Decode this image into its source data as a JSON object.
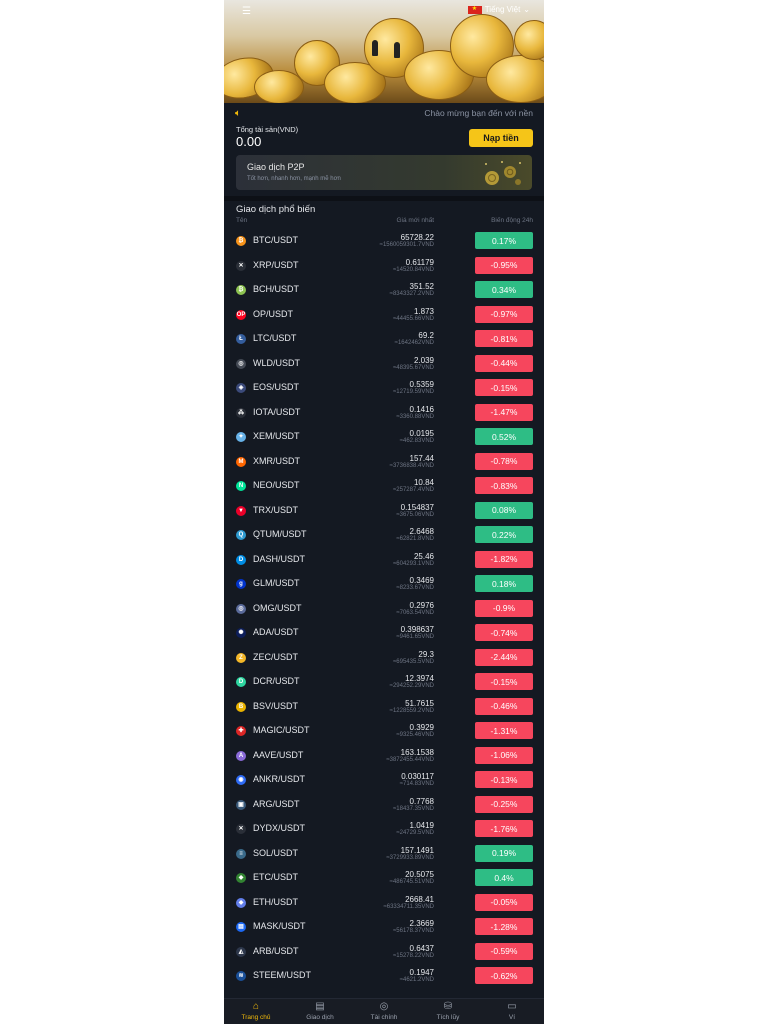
{
  "header": {
    "language": "Tiếng Việt",
    "notice": "Chào mừng bạn đến với nền"
  },
  "account": {
    "total_label": "Tổng tài sản(VND)",
    "total_value": "0.00",
    "deposit_label": "Nạp tiền"
  },
  "p2p": {
    "title": "Giao dịch P2P",
    "subtitle": "Tốt hơn, nhanh hơn, mạnh mẽ hơn"
  },
  "market": {
    "title": "Giao dịch phổ biến",
    "col_name": "Tên",
    "col_price": "Giá mới nhất",
    "col_change": "Biến động 24h",
    "rows": [
      {
        "pair": "BTC/USDT",
        "price": "65728.22",
        "vnd": "≈1560059301.7VND",
        "change": "0.17%",
        "dir": "up",
        "icon": "bitcoin-icon",
        "color": "#f7931a",
        "glyph": "₿"
      },
      {
        "pair": "XRP/USDT",
        "price": "0.61179",
        "vnd": "≈14520.84VND",
        "change": "-0.95%",
        "dir": "down",
        "icon": "xrp-icon",
        "color": "#2a2f38",
        "glyph": "✕"
      },
      {
        "pair": "BCH/USDT",
        "price": "351.52",
        "vnd": "≈8343327.2VND",
        "change": "0.34%",
        "dir": "up",
        "icon": "bitcoin-cash-icon",
        "color": "#8dc351",
        "glyph": "₿"
      },
      {
        "pair": "OP/USDT",
        "price": "1.873",
        "vnd": "≈44455.66VND",
        "change": "-0.97%",
        "dir": "down",
        "icon": "optimism-icon",
        "color": "#ff0420",
        "glyph": "OP"
      },
      {
        "pair": "LTC/USDT",
        "price": "69.2",
        "vnd": "≈1642462VND",
        "change": "-0.81%",
        "dir": "down",
        "icon": "litecoin-icon",
        "color": "#345d9d",
        "glyph": "Ł"
      },
      {
        "pair": "WLD/USDT",
        "price": "2.039",
        "vnd": "≈48395.67VND",
        "change": "-0.44%",
        "dir": "down",
        "icon": "worldcoin-icon",
        "color": "#444a55",
        "glyph": "◎"
      },
      {
        "pair": "EOS/USDT",
        "price": "0.5359",
        "vnd": "≈12719.59VND",
        "change": "-0.15%",
        "dir": "down",
        "icon": "eos-icon",
        "color": "#3b4a7a",
        "glyph": "◈"
      },
      {
        "pair": "IOTA/USDT",
        "price": "0.1416",
        "vnd": "≈3360.88VND",
        "change": "-1.47%",
        "dir": "down",
        "icon": "iota-icon",
        "color": "#2a2f38",
        "glyph": "⁂"
      },
      {
        "pair": "XEM/USDT",
        "price": "0.0195",
        "vnd": "≈462.83VND",
        "change": "0.52%",
        "dir": "up",
        "icon": "nem-icon",
        "color": "#67b2e8",
        "glyph": "✦"
      },
      {
        "pair": "XMR/USDT",
        "price": "157.44",
        "vnd": "≈3736838.4VND",
        "change": "-0.78%",
        "dir": "down",
        "icon": "monero-icon",
        "color": "#ff6600",
        "glyph": "M"
      },
      {
        "pair": "NEO/USDT",
        "price": "10.84",
        "vnd": "≈257287.4VND",
        "change": "-0.83%",
        "dir": "down",
        "icon": "neo-icon",
        "color": "#00e599",
        "glyph": "N"
      },
      {
        "pair": "TRX/USDT",
        "price": "0.154837",
        "vnd": "≈3675.06VND",
        "change": "0.08%",
        "dir": "up",
        "icon": "tron-icon",
        "color": "#eb0029",
        "glyph": "▼"
      },
      {
        "pair": "QTUM/USDT",
        "price": "2.6468",
        "vnd": "≈62821.8VND",
        "change": "0.22%",
        "dir": "up",
        "icon": "qtum-icon",
        "color": "#2e9ad0",
        "glyph": "Q"
      },
      {
        "pair": "DASH/USDT",
        "price": "25.46",
        "vnd": "≈604293.1VND",
        "change": "-1.82%",
        "dir": "down",
        "icon": "dash-icon",
        "color": "#008de4",
        "glyph": "D"
      },
      {
        "pair": "GLM/USDT",
        "price": "0.3469",
        "vnd": "≈8233.67VND",
        "change": "0.18%",
        "dir": "up",
        "icon": "golem-icon",
        "color": "#0033cc",
        "glyph": "g"
      },
      {
        "pair": "OMG/USDT",
        "price": "0.2976",
        "vnd": "≈7063.54VND",
        "change": "-0.9%",
        "dir": "down",
        "icon": "omg-icon",
        "color": "#5a6a9a",
        "glyph": "◎"
      },
      {
        "pair": "ADA/USDT",
        "price": "0.398637",
        "vnd": "≈9461.65VND",
        "change": "-0.74%",
        "dir": "down",
        "icon": "cardano-icon",
        "color": "#0d1e5a",
        "glyph": "✺"
      },
      {
        "pair": "ZEC/USDT",
        "price": "29.3",
        "vnd": "≈695435.5VND",
        "change": "-2.44%",
        "dir": "down",
        "icon": "zcash-icon",
        "color": "#f4b728",
        "glyph": "Z"
      },
      {
        "pair": "DCR/USDT",
        "price": "12.3974",
        "vnd": "≈294252.29VND",
        "change": "-0.15%",
        "dir": "down",
        "icon": "decred-icon",
        "color": "#2ed6a1",
        "glyph": "D"
      },
      {
        "pair": "BSV/USDT",
        "price": "51.7615",
        "vnd": "≈1228559.2VND",
        "change": "-0.46%",
        "dir": "down",
        "icon": "bitcoin-sv-icon",
        "color": "#eab300",
        "glyph": "B"
      },
      {
        "pair": "MAGIC/USDT",
        "price": "0.3929",
        "vnd": "≈9325.46VND",
        "change": "-1.31%",
        "dir": "down",
        "icon": "magic-icon",
        "color": "#dc2626",
        "glyph": "✚"
      },
      {
        "pair": "AAVE/USDT",
        "price": "163.1538",
        "vnd": "≈3872455.44VND",
        "change": "-1.06%",
        "dir": "down",
        "icon": "aave-icon",
        "color": "#8a6ad8",
        "glyph": "A"
      },
      {
        "pair": "ANKR/USDT",
        "price": "0.030117",
        "vnd": "≈714.83VND",
        "change": "-0.13%",
        "dir": "down",
        "icon": "ankr-icon",
        "color": "#2e6bf5",
        "glyph": "◉"
      },
      {
        "pair": "ARG/USDT",
        "price": "0.7768",
        "vnd": "≈18437.35VND",
        "change": "-0.25%",
        "dir": "down",
        "icon": "arg-icon",
        "color": "#3a5a7a",
        "glyph": "▣"
      },
      {
        "pair": "DYDX/USDT",
        "price": "1.0419",
        "vnd": "≈24729.5VND",
        "change": "-1.76%",
        "dir": "down",
        "icon": "dydx-icon",
        "color": "#2a2f38",
        "glyph": "✕"
      },
      {
        "pair": "SOL/USDT",
        "price": "157.1491",
        "vnd": "≈3729933.89VND",
        "change": "0.19%",
        "dir": "up",
        "icon": "solana-icon",
        "color": "#3a6a8a",
        "glyph": "≡"
      },
      {
        "pair": "ETC/USDT",
        "price": "20.5075",
        "vnd": "≈486745.51VND",
        "change": "0.4%",
        "dir": "up",
        "icon": "ethereum-classic-icon",
        "color": "#328332",
        "glyph": "◆"
      },
      {
        "pair": "ETH/USDT",
        "price": "2668.41",
        "vnd": "≈63334711.35VND",
        "change": "-0.05%",
        "dir": "down",
        "icon": "ethereum-icon",
        "color": "#627eea",
        "glyph": "◆"
      },
      {
        "pair": "MASK/USDT",
        "price": "2.3669",
        "vnd": "≈56178.37VND",
        "change": "-1.28%",
        "dir": "down",
        "icon": "mask-icon",
        "color": "#1c68f3",
        "glyph": "▤"
      },
      {
        "pair": "ARB/USDT",
        "price": "0.6437",
        "vnd": "≈15278.22VND",
        "change": "-0.59%",
        "dir": "down",
        "icon": "arbitrum-icon",
        "color": "#2d374b",
        "glyph": "◭"
      },
      {
        "pair": "STEEM/USDT",
        "price": "0.1947",
        "vnd": "≈4621.2VND",
        "change": "-0.62%",
        "dir": "down",
        "icon": "steem-icon",
        "color": "#1a5099",
        "glyph": "≋"
      }
    ]
  },
  "tabs": [
    {
      "label": "Trang chủ",
      "icon": "home-icon",
      "glyph": "⌂",
      "active": true
    },
    {
      "label": "Giao dịch",
      "icon": "trade-icon",
      "glyph": "▤",
      "active": false
    },
    {
      "label": "Tài chính",
      "icon": "finance-icon",
      "glyph": "◎",
      "active": false
    },
    {
      "label": "Tích lũy",
      "icon": "savings-icon",
      "glyph": "⛁",
      "active": false
    },
    {
      "label": "Ví",
      "icon": "wallet-icon",
      "glyph": "▭",
      "active": false
    }
  ]
}
